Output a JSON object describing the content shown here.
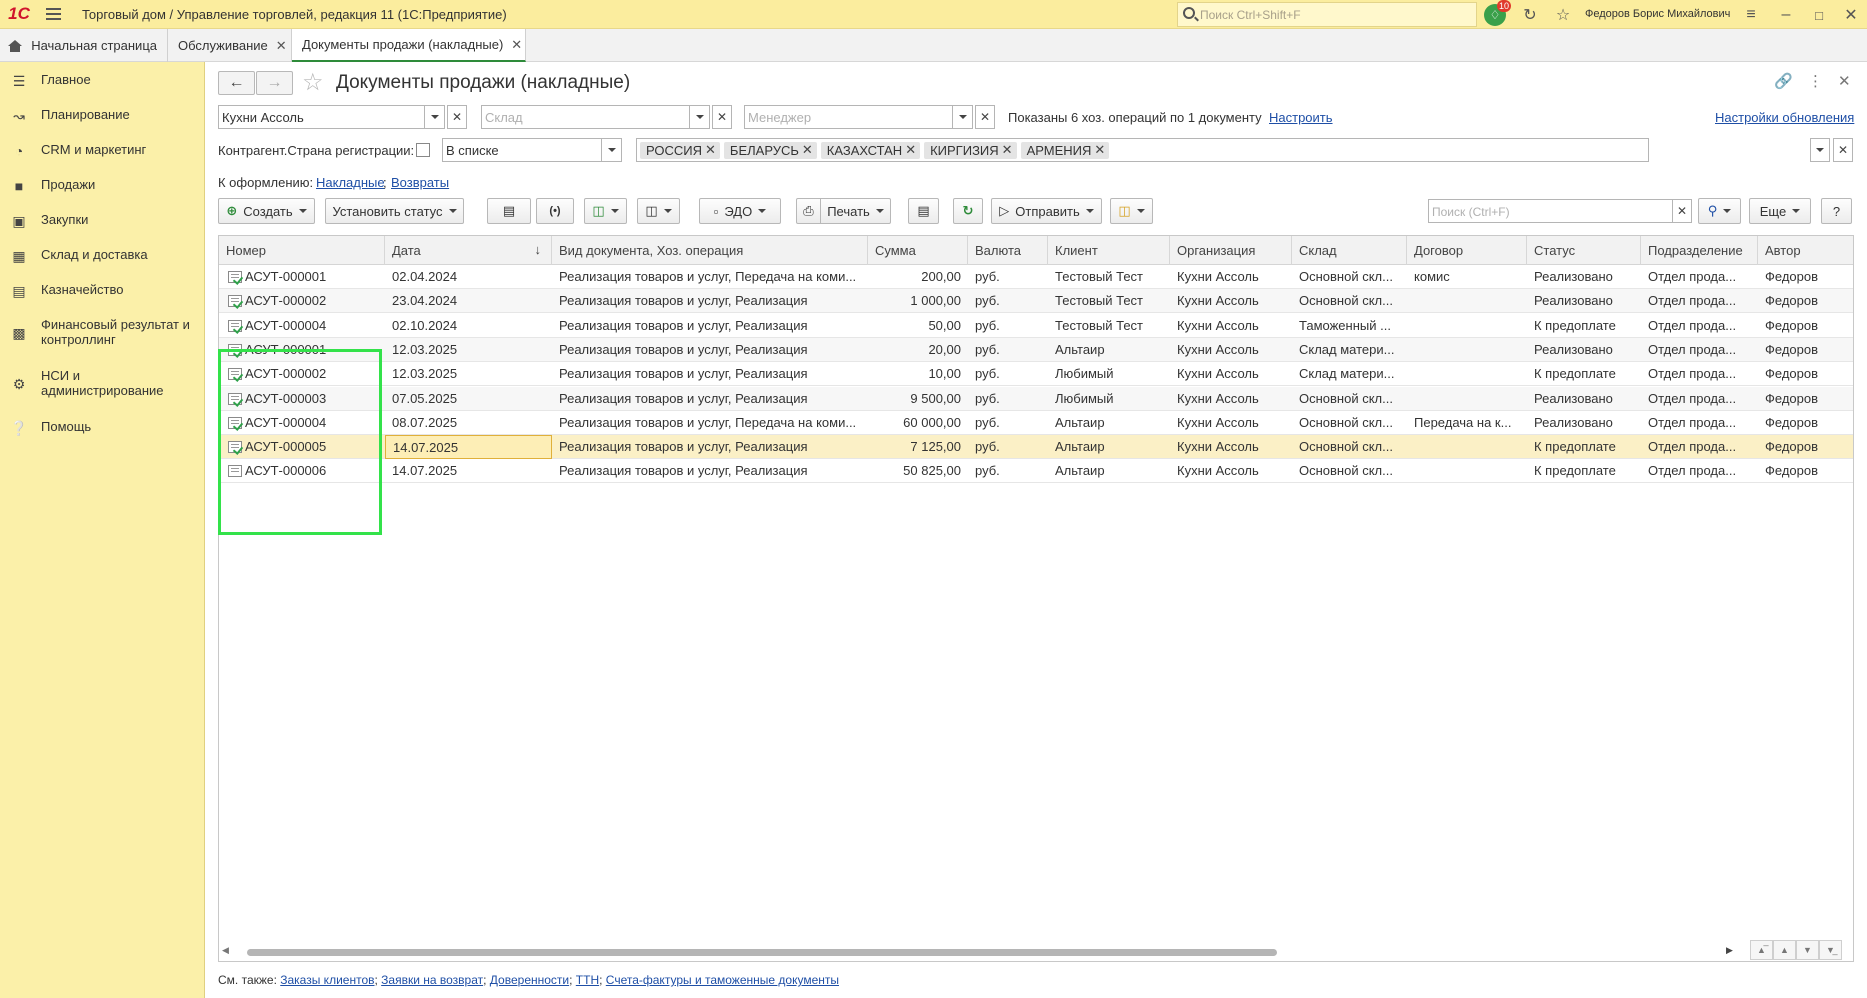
{
  "app": {
    "logo": "1С",
    "title": "Торговый дом / Управление торговлей, редакция 11  (1С:Предприятие)",
    "search_placeholder": "Поиск Ctrl+Shift+F",
    "notifications_count": "10",
    "user": "Федоров Борис Михайлович"
  },
  "tabs": [
    {
      "label": "Начальная страница"
    },
    {
      "label": "Обслуживание"
    },
    {
      "label": "Документы продажи (накладные)"
    }
  ],
  "sidebar": {
    "items": [
      {
        "label": "Главное",
        "icon": "menu-icon"
      },
      {
        "label": "Планирование",
        "icon": "planning-icon"
      },
      {
        "label": "CRM и маркетинг",
        "icon": "crm-icon"
      },
      {
        "label": "Продажи",
        "icon": "bag-icon"
      },
      {
        "label": "Закупки",
        "icon": "cart-icon"
      },
      {
        "label": "Склад и доставка",
        "icon": "warehouse-icon"
      },
      {
        "label": "Казначейство",
        "icon": "treasury-icon"
      },
      {
        "label": "Финансовый результат и контроллинг",
        "icon": "chart-icon"
      },
      {
        "label": "НСИ и администрирование",
        "icon": "gear-icon"
      },
      {
        "label": "Помощь",
        "icon": "help-icon"
      }
    ]
  },
  "page": {
    "title": "Документы продажи (накладные)"
  },
  "filters": {
    "organization": "Кухни Ассоль",
    "warehouse_placeholder": "Склад",
    "manager_placeholder": "Менеджер",
    "shown_text": "Показаны 6 хоз. операций по 1 документу",
    "configure_link": "Настроить",
    "update_settings_link": "Настройки обновления",
    "country_label": "Контрагент.Страна регистрации:",
    "country_mode": "В списке",
    "countries": [
      "РОССИЯ",
      "БЕЛАРУСЬ",
      "КАЗАХСТАН",
      "КИРГИЗИЯ",
      "АРМЕНИЯ"
    ],
    "to_process_label": "К оформлению:",
    "to_process_links": [
      "Накладные",
      "Возвраты"
    ]
  },
  "toolbar": {
    "create": "Создать",
    "set_status": "Установить статус",
    "edo": "ЭДО",
    "print": "Печать",
    "send": "Отправить",
    "search_placeholder": "Поиск (Ctrl+F)",
    "more": "Еще",
    "help": "?"
  },
  "table": {
    "columns": [
      "Номер",
      "Дата",
      "Вид документа, Хоз. операция",
      "Сумма",
      "Валюта",
      "Клиент",
      "Организация",
      "Склад",
      "Договор",
      "Статус",
      "Подразделение",
      "Автор"
    ],
    "rows": [
      {
        "num": "АСУТ-000001",
        "date": "02.04.2024",
        "kind": "Реализация товаров и услуг, Передача на коми...",
        "sum": "200,00",
        "cur": "руб.",
        "client": "Тестовый Тест",
        "org": "Кухни Ассоль",
        "wh": "Основной скл...",
        "contract": "комис",
        "status": "Реализовано",
        "dept": "Отдел прода...",
        "author": "Федоров",
        "posted": true
      },
      {
        "num": "АСУТ-000002",
        "date": "23.04.2024",
        "kind": "Реализация товаров и услуг, Реализация",
        "sum": "1 000,00",
        "cur": "руб.",
        "client": "Тестовый Тест",
        "org": "Кухни Ассоль",
        "wh": "Основной скл...",
        "contract": "",
        "status": "Реализовано",
        "dept": "Отдел прода...",
        "author": "Федоров",
        "posted": true
      },
      {
        "num": "АСУТ-000004",
        "date": "02.10.2024",
        "kind": "Реализация товаров и услуг, Реализация",
        "sum": "50,00",
        "cur": "руб.",
        "client": "Тестовый Тест",
        "org": "Кухни Ассоль",
        "wh": "Таможенный ...",
        "contract": "",
        "status": "К предоплате",
        "dept": "Отдел прода...",
        "author": "Федоров",
        "posted": true
      },
      {
        "num": "АСУТ-000001",
        "date": "12.03.2025",
        "kind": "Реализация товаров и услуг, Реализация",
        "sum": "20,00",
        "cur": "руб.",
        "client": "Альтаир",
        "org": "Кухни Ассоль",
        "wh": "Склад матери...",
        "contract": "",
        "status": "Реализовано",
        "dept": "Отдел прода...",
        "author": "Федоров",
        "posted": true
      },
      {
        "num": "АСУТ-000002",
        "date": "12.03.2025",
        "kind": "Реализация товаров и услуг, Реализация",
        "sum": "10,00",
        "cur": "руб.",
        "client": "Любимый",
        "org": "Кухни Ассоль",
        "wh": "Склад матери...",
        "contract": "",
        "status": "К предоплате",
        "dept": "Отдел прода...",
        "author": "Федоров",
        "posted": true
      },
      {
        "num": "АСУТ-000003",
        "date": "07.05.2025",
        "kind": "Реализация товаров и услуг, Реализация",
        "sum": "9 500,00",
        "cur": "руб.",
        "client": "Любимый",
        "org": "Кухни Ассоль",
        "wh": "Основной скл...",
        "contract": "",
        "status": "Реализовано",
        "dept": "Отдел прода...",
        "author": "Федоров",
        "posted": true
      },
      {
        "num": "АСУТ-000004",
        "date": "08.07.2025",
        "kind": "Реализация товаров и услуг, Передача на коми...",
        "sum": "60 000,00",
        "cur": "руб.",
        "client": "Альтаир",
        "org": "Кухни Ассоль",
        "wh": "Основной скл...",
        "contract": "Передача на к...",
        "status": "Реализовано",
        "dept": "Отдел прода...",
        "author": "Федоров",
        "posted": true
      },
      {
        "num": "АСУТ-000005",
        "date": "14.07.2025",
        "kind": "Реализация товаров и услуг, Реализация",
        "sum": "7 125,00",
        "cur": "руб.",
        "client": "Альтаир",
        "org": "Кухни Ассоль",
        "wh": "Основной скл...",
        "contract": "",
        "status": "К предоплате",
        "dept": "Отдел прода...",
        "author": "Федоров",
        "posted": true
      },
      {
        "num": "АСУТ-000006",
        "date": "14.07.2025",
        "kind": "Реализация товаров и услуг, Реализация",
        "sum": "50 825,00",
        "cur": "руб.",
        "client": "Альтаир",
        "org": "Кухни Ассоль",
        "wh": "Основной скл...",
        "contract": "",
        "status": "К предоплате",
        "dept": "Отдел прода...",
        "author": "Федоров",
        "posted": false
      }
    ]
  },
  "footer": {
    "label": "См. также:",
    "links": [
      "Заказы клиентов",
      "Заявки на возврат",
      "Доверенности",
      "ТТН",
      "Счета-фактуры и таможенные документы"
    ]
  },
  "colors": {
    "titlebar": "#fbed9e",
    "sidebar": "#fbf0a9",
    "selected_row": "#fbf0c6",
    "highlight": "#33e24a",
    "link": "#1f4fa6"
  }
}
